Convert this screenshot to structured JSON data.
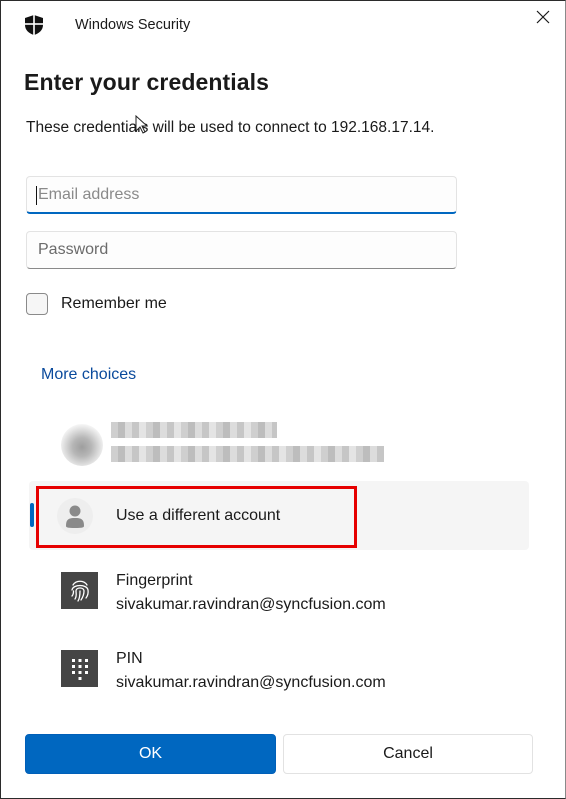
{
  "window": {
    "app_title": "Windows Security",
    "close_icon": "close-icon",
    "app_icon": "shield-icon"
  },
  "dialog": {
    "heading": "Enter your credentials",
    "description": "These credentials will be used to connect to 192.168.17.14."
  },
  "form": {
    "email_placeholder": "Email address",
    "email_value": "",
    "password_placeholder": "Password",
    "password_value": "",
    "remember_label": "Remember me",
    "remember_checked": false
  },
  "more_choices": {
    "label": "More choices",
    "items": [
      {
        "type": "redacted-account",
        "icon": "avatar-icon",
        "title": "",
        "subtitle": ""
      },
      {
        "type": "different-account",
        "icon": "person-icon",
        "title": "Use a different account",
        "selected": true
      },
      {
        "type": "fingerprint",
        "icon": "fingerprint-icon",
        "title": "Fingerprint",
        "subtitle": "sivakumar.ravindran@syncfusion.com"
      },
      {
        "type": "pin",
        "icon": "pin-keypad-icon",
        "title": "PIN",
        "subtitle": "sivakumar.ravindran@syncfusion.com"
      }
    ]
  },
  "buttons": {
    "ok": "OK",
    "cancel": "Cancel"
  },
  "colors": {
    "accent": "#0067c0",
    "link": "#0a4a9c",
    "annotation_highlight": "#e60000",
    "tile": "#454545"
  }
}
